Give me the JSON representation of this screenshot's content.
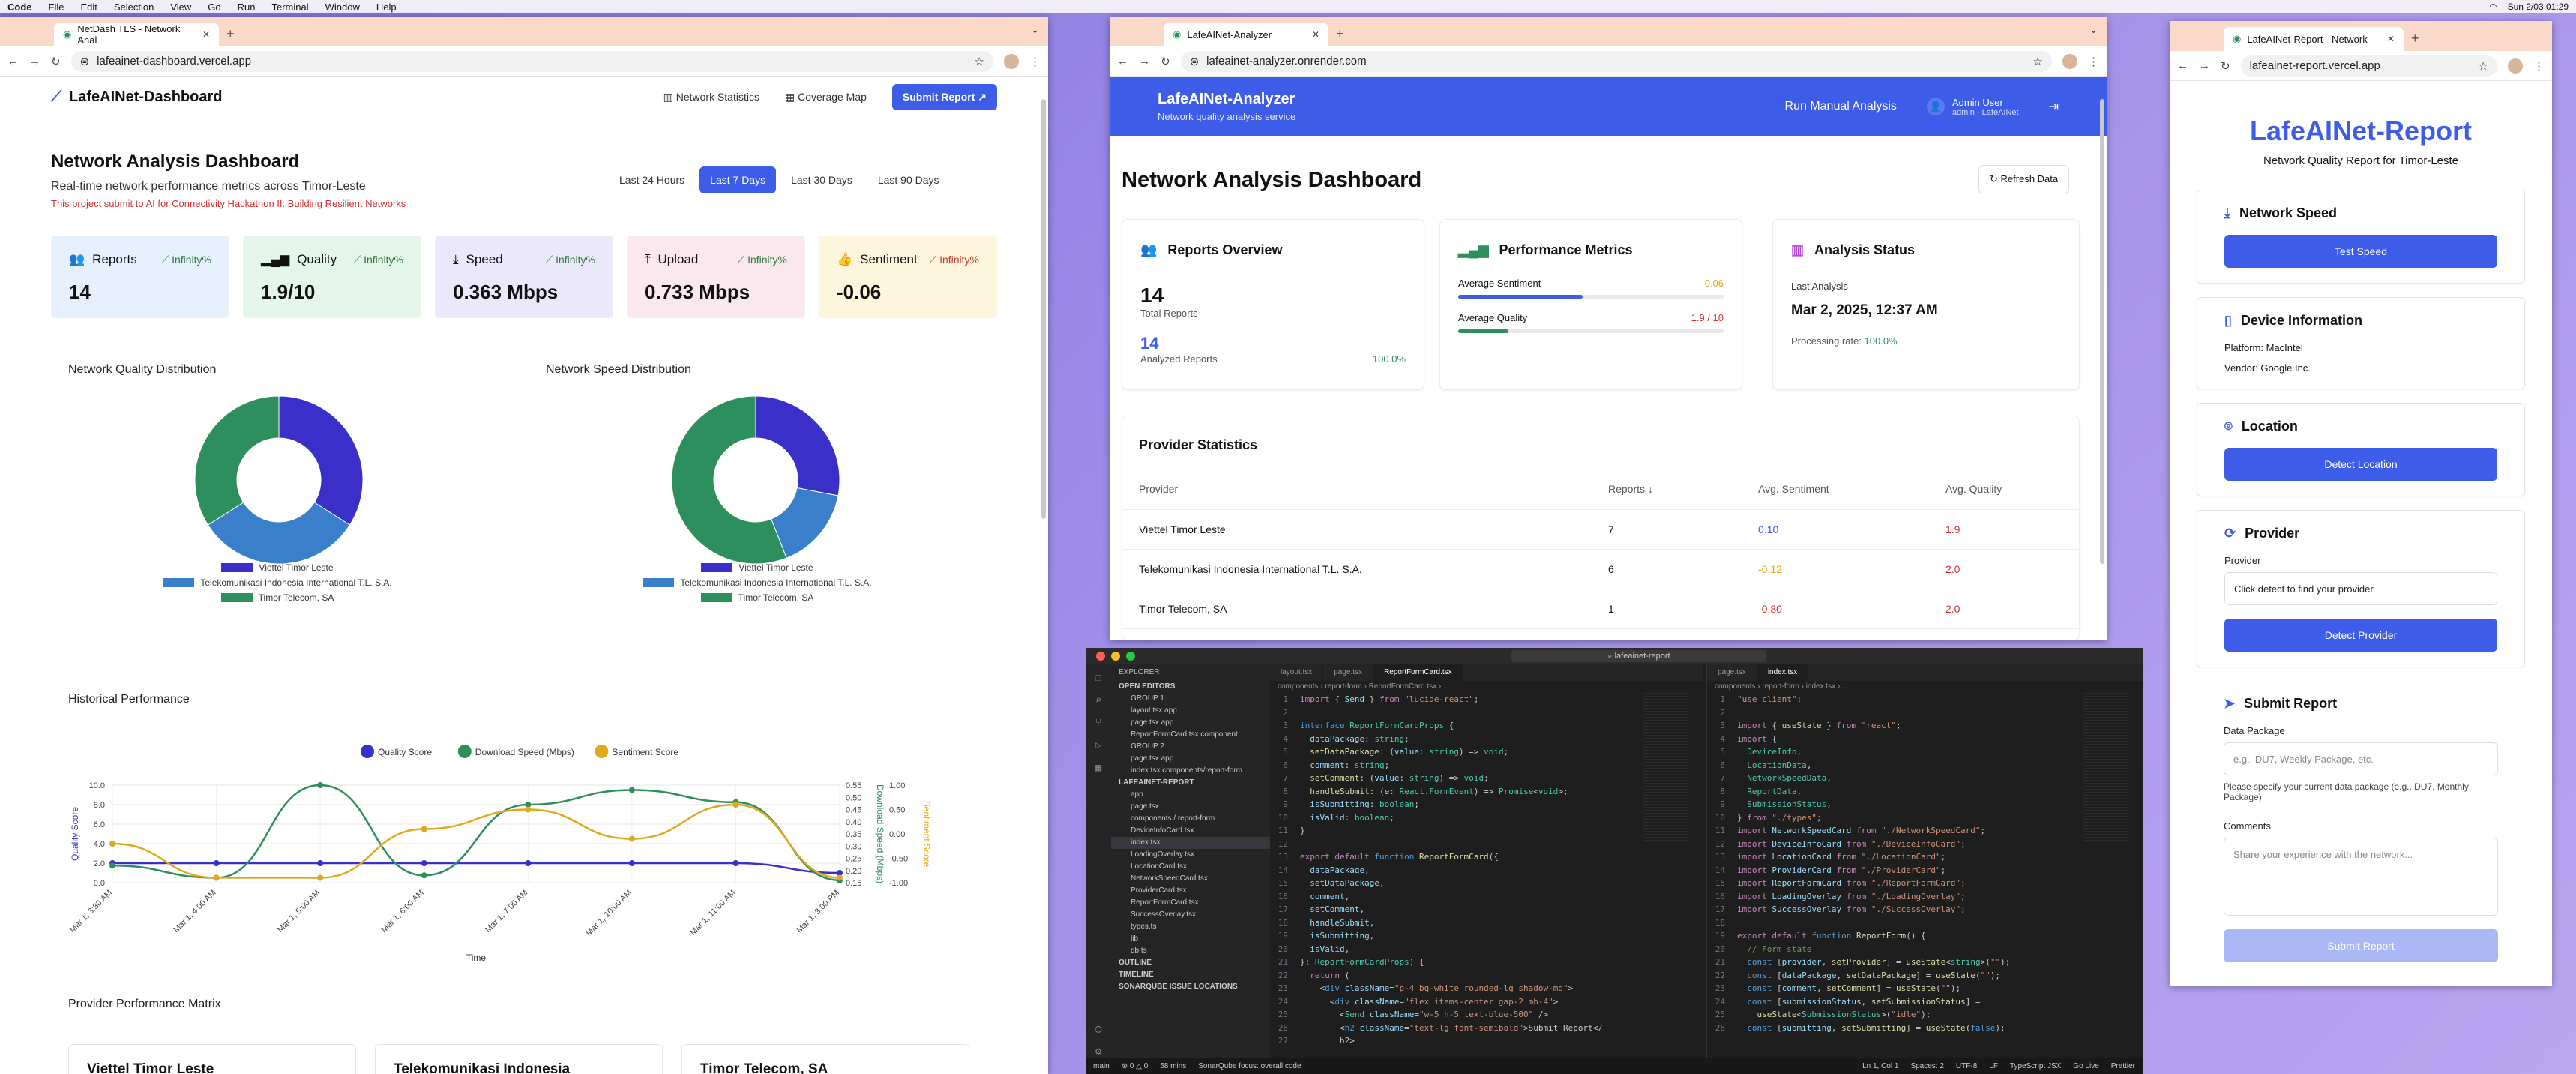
{
  "menubar": {
    "app": "Code",
    "items": [
      "File",
      "Edit",
      "Selection",
      "View",
      "Go",
      "Run",
      "Terminal",
      "Window",
      "Help"
    ],
    "clock": "Sun 2/03 01:29"
  },
  "w1": {
    "tab_title": "NetDash TLS - Network Anal",
    "url": "lafeainet-dashboard.vercel.app",
    "brand": "LafeAINet-Dashboard",
    "nav_stats": "Network Statistics",
    "nav_map": "Coverage Map",
    "nav_submit": "Submit Report",
    "title": "Network Analysis Dashboard",
    "subtitle": "Real-time network performance metrics across Timor-Leste",
    "notice_prefix": "This project submit to ",
    "notice_link": "AI for Connectivity Hackathon II: Building Resilient Networks",
    "ranges": [
      "Last 24 Hours",
      "Last 7 Days",
      "Last 30 Days",
      "Last 90 Days"
    ],
    "cards": [
      {
        "label": "Reports",
        "trend": "Infinity%",
        "value": "14",
        "bg": "#e6effc",
        "tc": "#2f7a3b"
      },
      {
        "label": "Quality",
        "trend": "Infinity%",
        "value": "1.9/10",
        "bg": "#e4f6ea",
        "tc": "#2f7a3b"
      },
      {
        "label": "Speed",
        "trend": "Infinity%",
        "value": "0.363 Mbps",
        "bg": "#ece8fb",
        "tc": "#2f7a3b"
      },
      {
        "label": "Upload",
        "trend": "Infinity%",
        "value": "0.733 Mbps",
        "bg": "#fbe8ef",
        "tc": "#2f7a3b"
      },
      {
        "label": "Sentiment",
        "trend": "Infinity%",
        "value": "-0.06",
        "bg": "#fdf5dc",
        "tc": "#c0392b"
      }
    ],
    "quality_title": "Network Quality Distribution",
    "speed_title": "Network Speed Distribution",
    "legend": [
      "Viettel Timor Leste",
      "Telekomunikasi Indonesia International T.L. S.A.",
      "Timor Telecom, SA"
    ],
    "hist_title": "Historical Performance",
    "matrix_title": "Provider Performance Matrix",
    "matrix_cards": [
      "Viettel Timor Leste",
      "Telekomunikasi Indonesia",
      "Timor Telecom, SA"
    ]
  },
  "chart_data": [
    {
      "type": "pie",
      "title": "Network Quality Distribution",
      "categories": [
        "Viettel Timor Leste",
        "Telekomunikasi Indonesia International T.L. S.A.",
        "Timor Telecom, SA"
      ],
      "values": [
        34,
        32,
        34
      ],
      "colors": [
        "#3a2fc9",
        "#3a7fc9",
        "#2e8f5e"
      ]
    },
    {
      "type": "pie",
      "title": "Network Speed Distribution",
      "categories": [
        "Viettel Timor Leste",
        "Telekomunikasi Indonesia International T.L. S.A.",
        "Timor Telecom, SA"
      ],
      "values": [
        28,
        16,
        56
      ],
      "colors": [
        "#3a2fc9",
        "#3a7fc9",
        "#2e8f5e"
      ]
    },
    {
      "type": "line",
      "title": "Historical Performance",
      "xlabel": "Time",
      "ylabel": "Quality Score",
      "ylabel_right": "Download Speed (Mbps)",
      "ylabel_right2": "Sentiment Score",
      "x": [
        "Mar 1, 3:30 AM",
        "Mar 1, 4:00 AM",
        "Mar 1, 5:00 AM",
        "Mar 1, 6:00 AM",
        "Mar 1, 7:00 AM",
        "Mar 1, 10:00 AM",
        "Mar 1, 11:00 AM",
        "Mar 1, 3:00 PM"
      ],
      "yticks_left": [
        "0.0",
        "2.0",
        "4.0",
        "6.0",
        "8.0",
        "10.0"
      ],
      "yticks_right": [
        "0.15",
        "0.20",
        "0.25",
        "0.30",
        "0.35",
        "0.40",
        "0.45",
        "0.50",
        "0.55"
      ],
      "yticks_right2": [
        "-1.00",
        "-0.50",
        "0.00",
        "0.50",
        "1.00"
      ],
      "series": [
        {
          "name": "Quality Score",
          "axis": "left",
          "color": "#3a2fc9",
          "values": [
            2.0,
            2.0,
            2.0,
            2.0,
            2.0,
            2.0,
            2.0,
            1.0
          ]
        },
        {
          "name": "Download Speed (Mbps)",
          "axis": "right",
          "color": "#2e8f5e",
          "values": [
            0.22,
            0.17,
            0.55,
            0.18,
            0.47,
            0.53,
            0.48,
            0.16
          ]
        },
        {
          "name": "Sentiment Score",
          "axis": "right2",
          "color": "#e0a81c",
          "values": [
            -0.2,
            -0.9,
            -0.9,
            0.1,
            0.5,
            -0.1,
            0.6,
            -0.9
          ]
        }
      ]
    }
  ],
  "w2": {
    "tab_title": "LafeAINet-Analyzer",
    "url": "lafeainet-analyzer.onrender.com",
    "brand": "LafeAINet-Analyzer",
    "brand_sub": "Network quality analysis service",
    "run": "Run Manual Analysis",
    "user": "Admin User",
    "user_sub": "admin · LafeAINet",
    "title": "Network Analysis Dashboard",
    "refresh": "Refresh Data",
    "reports": {
      "title": "Reports Overview",
      "total": "14",
      "total_lbl": "Total Reports",
      "analyzed": "14",
      "analyzed_lbl": "Analyzed Reports",
      "pct": "100.0%"
    },
    "perf": {
      "title": "Performance Metrics",
      "sent_lbl": "Average Sentiment",
      "sent_val": "-0.06",
      "sent_fill": 0.47,
      "qual_lbl": "Average Quality",
      "qual_val": "1.9 / 10",
      "qual_fill": 0.19
    },
    "status": {
      "title": "Analysis Status",
      "last_lbl": "Last Analysis",
      "last": "Mar 2, 2025, 12:37 AM",
      "rate_lbl": "Processing rate: ",
      "rate": "100.0%"
    },
    "prov_title": "Provider Statistics",
    "cols": [
      "Provider",
      "Reports ↓",
      "Avg. Sentiment",
      "Avg. Quality"
    ],
    "rows": [
      {
        "p": "Viettel Timor Leste",
        "r": "7",
        "s": "0.10",
        "sc": "#3d5ce8",
        "q": "1.9"
      },
      {
        "p": "Telekomunikasi Indonesia International T.L. S.A.",
        "r": "6",
        "s": "-0.12",
        "sc": "#e0a81c",
        "q": "2.0"
      },
      {
        "p": "Timor Telecom, SA",
        "r": "1",
        "s": "-0.80",
        "sc": "#d63031",
        "q": "2.0"
      }
    ]
  },
  "w3": {
    "tab_title": "LafeAINet-Report - Network",
    "url": "lafeainet-report.vercel.app",
    "title": "LafeAINet-Report",
    "subtitle": "Network Quality Report for Timor-Leste",
    "speed_h": "Network Speed",
    "speed_btn": "Test Speed",
    "dev_h": "Device Information",
    "platform": "Platform: MacIntel",
    "vendor": "Vendor: Google Inc.",
    "loc_h": "Location",
    "loc_btn": "Detect Location",
    "prov_h": "Provider",
    "prov_lbl": "Provider",
    "prov_val": "Click detect to find your provider",
    "prov_btn": "Detect Provider",
    "sub_h": "Submit Report",
    "pkg_lbl": "Data Package",
    "pkg_ph": "e.g., DU7, Weekly Package, etc.",
    "pkg_help": "Please specify your current data package (e.g., DU7, Monthly Package)",
    "cm_lbl": "Comments",
    "cm_ph": "Share your experience with the network...",
    "submit": "Submit Report"
  },
  "vs": {
    "search": "lafeainet-report",
    "explorer_title": "EXPLORER",
    "tree": [
      "OPEN EDITORS",
      "GROUP 1",
      "layout.tsx app",
      "page.tsx app",
      "ReportFormCard.tsx component",
      "GROUP 2",
      "page.tsx app",
      "index.tsx components/report-form",
      "LAFEAINET-REPORT",
      "app",
      "page.tsx",
      "components / report-form",
      "DeviceInfoCard.tsx",
      "index.tsx",
      "LoadingOverlay.tsx",
      "LocationCard.tsx",
      "NetworkSpeedCard.tsx",
      "ProviderCard.tsx",
      "ReportFormCard.tsx",
      "SuccessOverlay.tsx",
      "types.ts",
      "lib",
      "db.ts",
      "OUTLINE",
      "TIMELINE",
      "SONARQUBE ISSUE LOCATIONS"
    ],
    "tabs1": [
      "layout.tsx",
      "page.tsx",
      "ReportFormCard.tsx"
    ],
    "tabs2": [
      "page.tsx",
      "index.tsx"
    ],
    "crumb1": "components › report-form › ReportFormCard.tsx › ...",
    "crumb2": "components › report-form › index.tsx › ...",
    "status": [
      "main",
      "⊗ 0 △ 0",
      "58 mins",
      "SonarQube focus: overall code",
      "Ln 1, Col 1",
      "Spaces: 2",
      "UTF-8",
      "LF",
      "TypeScript JSX",
      "Go Live",
      "Prettier"
    ]
  }
}
